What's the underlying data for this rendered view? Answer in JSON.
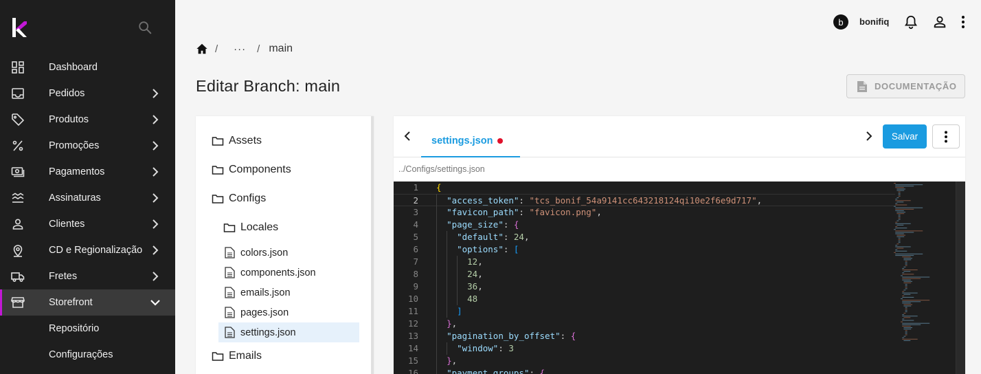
{
  "sidebar": {
    "search_icon": "search-icon",
    "items": [
      {
        "label": "Dashboard",
        "icon": "dashboard-icon",
        "has_children": false
      },
      {
        "label": "Pedidos",
        "icon": "inbox-icon",
        "has_children": true
      },
      {
        "label": "Produtos",
        "icon": "tag-icon",
        "has_children": true
      },
      {
        "label": "Promoções",
        "icon": "percent-icon",
        "has_children": true
      },
      {
        "label": "Pagamentos",
        "icon": "money-icon",
        "has_children": true
      },
      {
        "label": "Assinaturas",
        "icon": "waves-icon",
        "has_children": true
      },
      {
        "label": "Clientes",
        "icon": "person-icon",
        "has_children": true
      },
      {
        "label": "CD e Regionalização",
        "icon": "location-pin-icon",
        "has_children": true
      },
      {
        "label": "Fretes",
        "icon": "truck-icon",
        "has_children": true
      },
      {
        "label": "Storefront",
        "icon": "store-icon",
        "has_children": true,
        "expanded": true,
        "active": true
      }
    ],
    "subitems": [
      {
        "label": "Repositório"
      },
      {
        "label": "Configurações"
      }
    ],
    "accent_color": "#c218d6"
  },
  "topbar": {
    "avatar_letter": "b",
    "username": "bonifiq"
  },
  "breadcrumb": {
    "ellipsis": "···",
    "current": "main",
    "separator": "/"
  },
  "page": {
    "title": "Editar Branch: main",
    "doc_button": "DOCUMENTAÇÃO"
  },
  "tree": {
    "folders_top": [
      "Assets",
      "Components",
      "Configs"
    ],
    "subfolder": "Locales",
    "files": [
      "colors.json",
      "components.json",
      "emails.json",
      "pages.json",
      "settings.json"
    ],
    "selected_file": "settings.json",
    "folders_bottom": [
      "Emails"
    ]
  },
  "editor": {
    "tab_label": "settings.json",
    "tab_unsaved": true,
    "save_label": "Salvar",
    "file_path": "../Configs/settings.json",
    "accent_color": "#1a9be0",
    "current_line": 2,
    "lines": [
      "{",
      "  \"access_token\": \"tcs_bonif_54a9141cc643218124qi10e2f6e9d717\",",
      "  \"favicon_path\": \"favicon.png\",",
      "  \"page_size\": {",
      "    \"default\": 24,",
      "    \"options\": [",
      "      12,",
      "      24,",
      "      36,",
      "      48",
      "    ]",
      "  },",
      "  \"pagination_by_offset\": {",
      "    \"window\": 3",
      "  },",
      "  \"payment_groups\": {"
    ]
  }
}
